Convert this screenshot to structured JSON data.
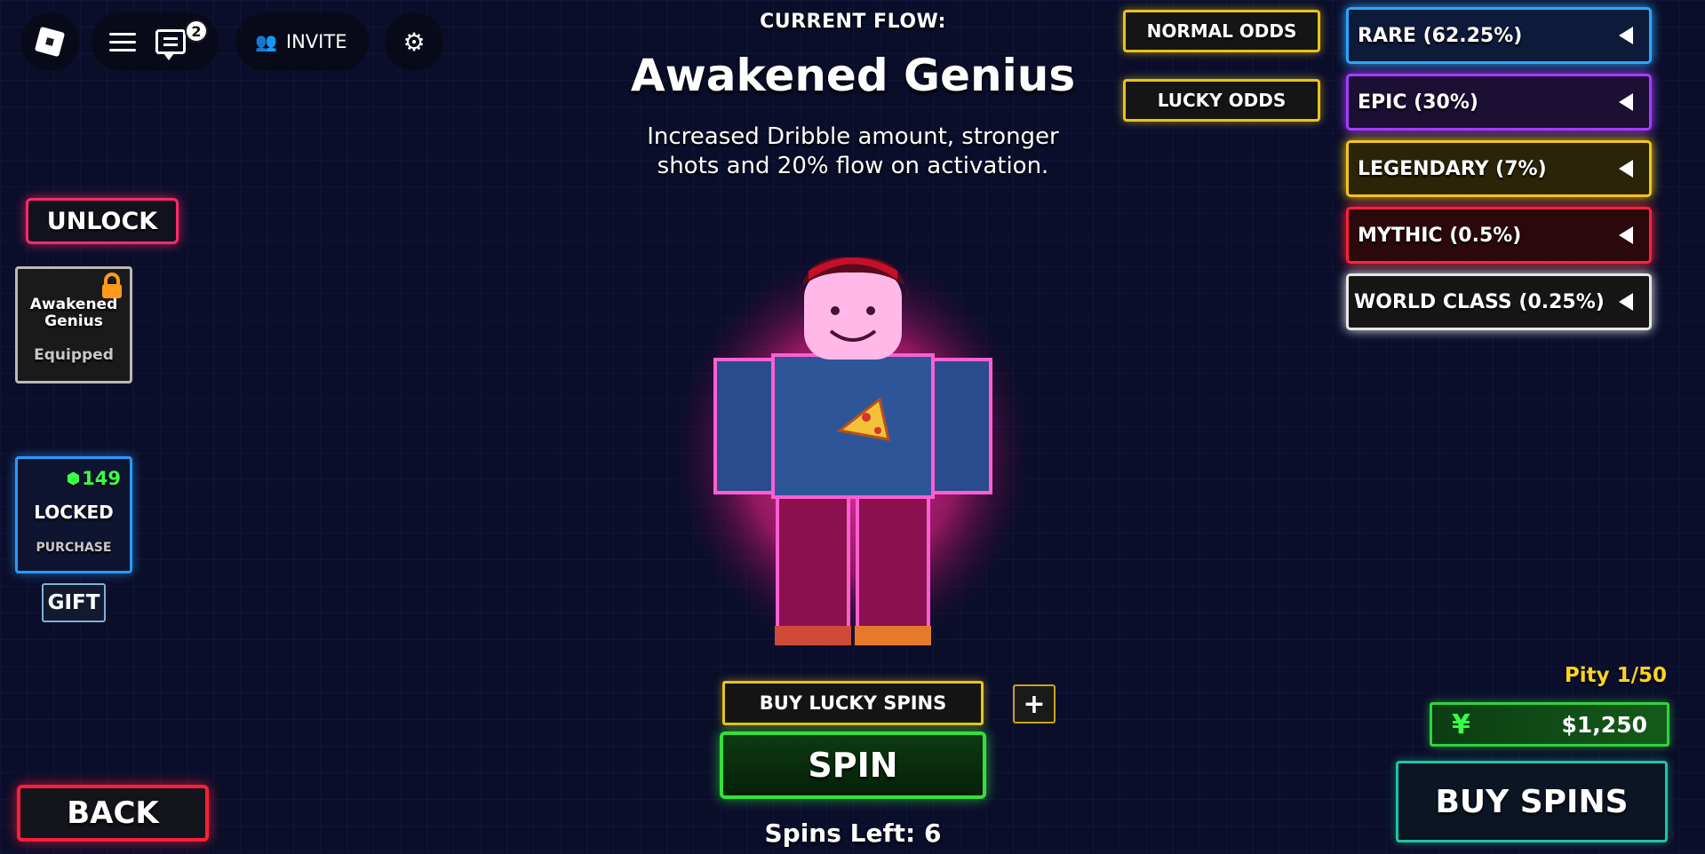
{
  "topbar": {
    "notification_count": "2",
    "invite_label": "INVITE"
  },
  "flow": {
    "heading": "CURRENT FLOW:",
    "name": "Awakened Genius",
    "description_line1": "Increased Dribble amount, stronger",
    "description_line2": "shots and 20% flow on activation."
  },
  "odds": {
    "normal_label": "NORMAL ODDS",
    "lucky_label": "LUCKY ODDS"
  },
  "rarities": [
    {
      "label": "RARE (62.25%)",
      "color": "#2aa8ff"
    },
    {
      "label": "EPIC (30%)",
      "color": "#a53cff"
    },
    {
      "label": "LEGENDARY (7%)",
      "color": "#f5c518"
    },
    {
      "label": "MYTHIC (0.5%)",
      "color": "#ff2233"
    },
    {
      "label": "WORLD CLASS (0.25%)",
      "color": "#e6e6e6"
    }
  ],
  "left_panel": {
    "unlock_label": "UNLOCK",
    "equipped_card": {
      "name_line1": "Awakened",
      "name_line2": "Genius",
      "status": "Equipped"
    },
    "locked_card": {
      "price": "149",
      "status": "LOCKED",
      "action": "PURCHASE"
    },
    "gift_label": "GIFT",
    "back_label": "BACK"
  },
  "spin_area": {
    "buy_lucky_label": "BUY LUCKY SPINS",
    "plus_label": "+",
    "spin_label": "SPIN",
    "spins_left": "Spins Left: 6"
  },
  "wallet": {
    "pity": "Pity 1/50",
    "currency_symbol": "¥",
    "balance": "$1,250",
    "buy_spins_label": "BUY SPINS"
  }
}
